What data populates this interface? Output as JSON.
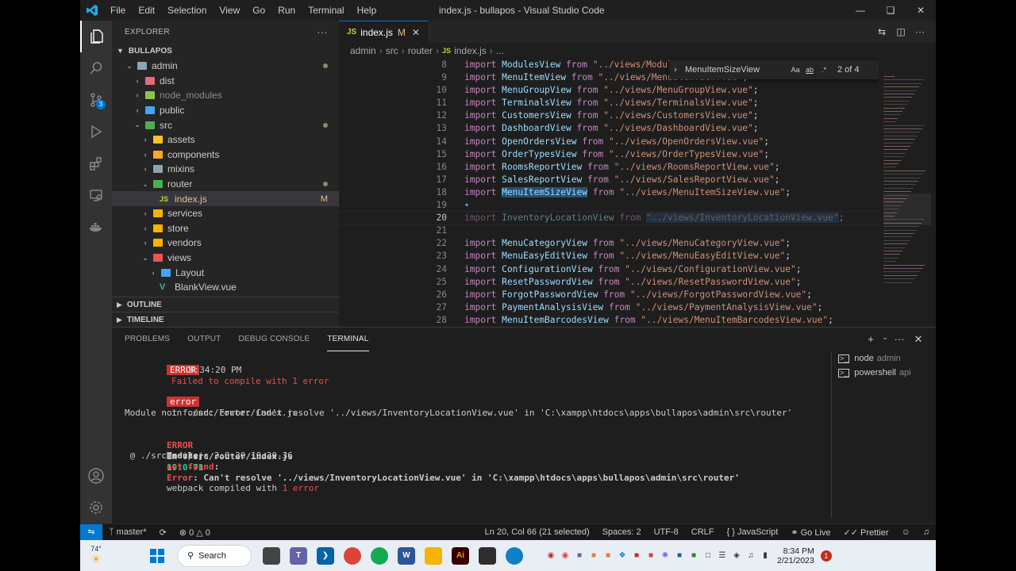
{
  "window": {
    "title": "index.js - bullapos - Visual Studio Code",
    "menu": [
      "File",
      "Edit",
      "Selection",
      "View",
      "Go",
      "Run",
      "Terminal",
      "Help"
    ]
  },
  "activity_bar": {
    "items": [
      "explorer-icon",
      "search-icon",
      "source-control-icon",
      "run-debug-icon",
      "extensions-icon",
      "remote-explorer-icon",
      "docker-icon"
    ],
    "source_control_badge": "3",
    "bottom": [
      "account-icon",
      "settings-gear-icon"
    ]
  },
  "explorer": {
    "header": "EXPLORER",
    "root": "BULLAPOS",
    "tree": [
      {
        "label": "admin",
        "depth": 1,
        "type": "folder",
        "open": true,
        "color": "#8aa4b8",
        "status": "dot"
      },
      {
        "label": "dist",
        "depth": 2,
        "type": "folder",
        "open": false,
        "color": "#e06c75",
        "status": ""
      },
      {
        "label": "node_modules",
        "depth": 2,
        "type": "folder",
        "open": false,
        "color": "#8bc34a",
        "status": "",
        "dim": true
      },
      {
        "label": "public",
        "depth": 2,
        "type": "folder",
        "open": false,
        "color": "#42a5f5",
        "status": ""
      },
      {
        "label": "src",
        "depth": 2,
        "type": "folder",
        "open": true,
        "color": "#4caf50",
        "status": "dot"
      },
      {
        "label": "assets",
        "depth": 3,
        "type": "folder",
        "open": false,
        "color": "#fbc02d",
        "status": ""
      },
      {
        "label": "components",
        "depth": 3,
        "type": "folder",
        "open": false,
        "color": "#f9a825",
        "status": ""
      },
      {
        "label": "mixins",
        "depth": 3,
        "type": "folder",
        "open": false,
        "color": "#90a4ae",
        "status": ""
      },
      {
        "label": "router",
        "depth": 3,
        "type": "folder",
        "open": true,
        "color": "#4caf50",
        "status": "dot"
      },
      {
        "label": "index.js",
        "depth": 4,
        "type": "js",
        "open": false,
        "color": "#cbcb41",
        "status": "M",
        "selected": true
      },
      {
        "label": "services",
        "depth": 3,
        "type": "folder",
        "open": false,
        "color": "#ffb300",
        "status": ""
      },
      {
        "label": "store",
        "depth": 3,
        "type": "folder",
        "open": false,
        "color": "#ffb300",
        "status": ""
      },
      {
        "label": "vendors",
        "depth": 3,
        "type": "folder",
        "open": false,
        "color": "#ffb300",
        "status": ""
      },
      {
        "label": "views",
        "depth": 3,
        "type": "folder",
        "open": true,
        "color": "#ef5350",
        "status": ""
      },
      {
        "label": "Layout",
        "depth": 4,
        "type": "folder",
        "open": false,
        "color": "#42a5f5",
        "status": ""
      },
      {
        "label": "BlankView.vue",
        "depth": 4,
        "type": "vue",
        "open": false,
        "color": "#41b883",
        "status": ""
      }
    ],
    "outline": "OUTLINE",
    "timeline": "TIMELINE"
  },
  "editor": {
    "tab": {
      "label": "index.js",
      "modified": "M"
    },
    "breadcrumb": [
      "admin",
      "src",
      "router",
      "index.js",
      "..."
    ],
    "find": {
      "query": "MenuItemSizeView",
      "count": "2 of 4",
      "options": [
        "Aa",
        "ab",
        ".*"
      ]
    },
    "lines": [
      {
        "n": "8",
        "id": "ModulesView",
        "path": "\"../views/ModulesView.vue\"",
        "tail": ";"
      },
      {
        "n": "9",
        "id": "MenuItemView",
        "path": "\"../views/MenuItemView.vue\"",
        "tail": ";"
      },
      {
        "n": "10",
        "id": "MenuGroupView",
        "path": "\"../views/MenuGroupView.vue\"",
        "tail": ";"
      },
      {
        "n": "11",
        "id": "TerminalsView",
        "path": "\"../views/TerminalsView.vue\"",
        "tail": ";"
      },
      {
        "n": "12",
        "id": "CustomersView",
        "path": "\"../views/CustomersView.vue\"",
        "tail": ";"
      },
      {
        "n": "13",
        "id": "DashboardView",
        "path": "\"../views/DashboardView.vue\"",
        "tail": ";"
      },
      {
        "n": "14",
        "id": "OpenOrdersView",
        "path": "\"../views/OpenOrdersView.vue\"",
        "tail": ";"
      },
      {
        "n": "15",
        "id": "OrderTypesView",
        "path": "\"../views/OrderTypesView.vue\"",
        "tail": ";"
      },
      {
        "n": "16",
        "id": "RoomsReportView",
        "path": "\"../views/RoomsReportView.vue\"",
        "tail": ";"
      },
      {
        "n": "17",
        "id": "SalesReportView",
        "path": "\"../views/SalesReportView.vue\"",
        "tail": ";"
      },
      {
        "n": "18",
        "id": "MenuItemSizeView",
        "path": "\"../views/MenuItemSizeView.vue\"",
        "tail": ";",
        "match": true
      },
      {
        "n": "19",
        "id": "",
        "path": "",
        "tail": "",
        "blank": true,
        "lightbulb": true
      },
      {
        "n": "20",
        "id": "InventoryLocationView",
        "path": "\"../views/InventoryLocationView.vue\"",
        "tail": ";",
        "faded": true,
        "current": true
      },
      {
        "n": "21",
        "id": "",
        "path": "",
        "tail": "",
        "blank": true
      },
      {
        "n": "22",
        "id": "MenuCategoryView",
        "path": "\"../views/MenuCategoryView.vue\"",
        "tail": ";"
      },
      {
        "n": "23",
        "id": "MenuEasyEditView",
        "path": "\"../views/MenuEasyEditView.vue\"",
        "tail": ";"
      },
      {
        "n": "24",
        "id": "ConfigurationView",
        "path": "\"../views/ConfigurationView.vue\"",
        "tail": ";"
      },
      {
        "n": "25",
        "id": "ResetPasswordView",
        "path": "\"../views/ResetPasswordView.vue\"",
        "tail": ";"
      },
      {
        "n": "26",
        "id": "ForgotPasswordView",
        "path": "\"../views/ForgotPasswordView.vue\"",
        "tail": ";"
      },
      {
        "n": "27",
        "id": "PaymentAnalysisView",
        "path": "\"../views/PaymentAnalysisView.vue\"",
        "tail": ";"
      },
      {
        "n": "28",
        "id": "MenuItemBarcodesView",
        "path": "\"../views/MenuItemBarcodesView.vue\"",
        "tail": ";"
      }
    ],
    "kw_import": "import",
    "kw_from": "from"
  },
  "panel": {
    "tabs": [
      "PROBLEMS",
      "OUTPUT",
      "DEBUG CONSOLE",
      "TERMINAL"
    ],
    "active_tab": "TERMINAL",
    "terminal": {
      "error_tag": "ERROR",
      "error_msg": "Failed to compile with 1 error",
      "time": "8:34:20 PM",
      "error_tag2": "error",
      "in_file": "in ./src/router/index.js",
      "module_not_found": "Module not found: Error: Can't resolve '../views/InventoryLocationView.vue' in 'C:\\xampp\\htdocs\\apps\\bullapos\\admin\\src\\router'",
      "err2_prefix": "ERROR",
      "err2_file": "in ./src/router/index.js",
      "err2_loc": "19:0-71",
      "mod2_a": "Module",
      "mod2_b": "not found",
      "mod2_c": ":",
      "mod2_d": "Error",
      "mod2_e": ": Can't resolve '../views/InventoryLocationView.vue' in 'C:\\xampp\\htdocs\\apps\\bullapos\\admin\\src\\router'",
      "at_line": " @ ./src/main.js 3:0-30 10:30-36",
      "compiled_a": "webpack compiled with ",
      "compiled_b": "1 error"
    },
    "terminals": [
      {
        "name": "node",
        "folder": "admin"
      },
      {
        "name": "powershell",
        "folder": "api"
      }
    ]
  },
  "statusbar": {
    "branch": "master*",
    "errors": "0",
    "warnings": "0",
    "position": "Ln 20, Col 66 (21 selected)",
    "spaces": "Spaces: 2",
    "encoding": "UTF-8",
    "eol": "CRLF",
    "language": "JavaScript",
    "golive": "Go Live",
    "prettier": "Prettier"
  },
  "taskbar": {
    "weather": "74°",
    "search": "Search",
    "time": "8:34 PM",
    "date": "2/21/2023",
    "notifications": "1"
  },
  "colors": {
    "accent": "#0078d4",
    "keyword": "#c586c0",
    "identifier": "#9cdcfe",
    "string": "#ce9178",
    "error": "#cd3131"
  }
}
